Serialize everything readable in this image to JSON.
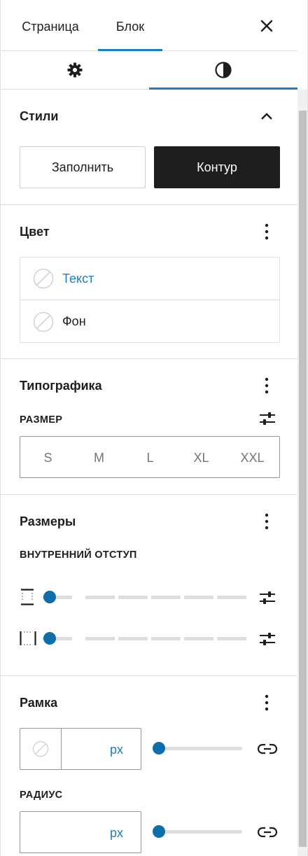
{
  "tabs": {
    "page": "Страница",
    "block": "Блок"
  },
  "sections": {
    "styles": {
      "title": "Стили",
      "fill": "Заполнить",
      "outline": "Контур"
    },
    "color": {
      "title": "Цвет",
      "items": [
        "Текст",
        "Фон"
      ]
    },
    "typography": {
      "title": "Типографика",
      "size_label": "РАЗМЕР",
      "sizes": [
        "S",
        "M",
        "L",
        "XL",
        "XXL"
      ]
    },
    "dimensions": {
      "title": "Размеры",
      "padding_label": "ВНУТРЕННИЙ ОТСТУП"
    },
    "border": {
      "title": "Рамка",
      "unit": "px",
      "radius_label": "РАДИУС",
      "radius_unit": "px"
    }
  },
  "colors": {
    "accent": "#1e7fc0",
    "slider": "#0d6eaa",
    "dark": "#1e1e1e"
  }
}
